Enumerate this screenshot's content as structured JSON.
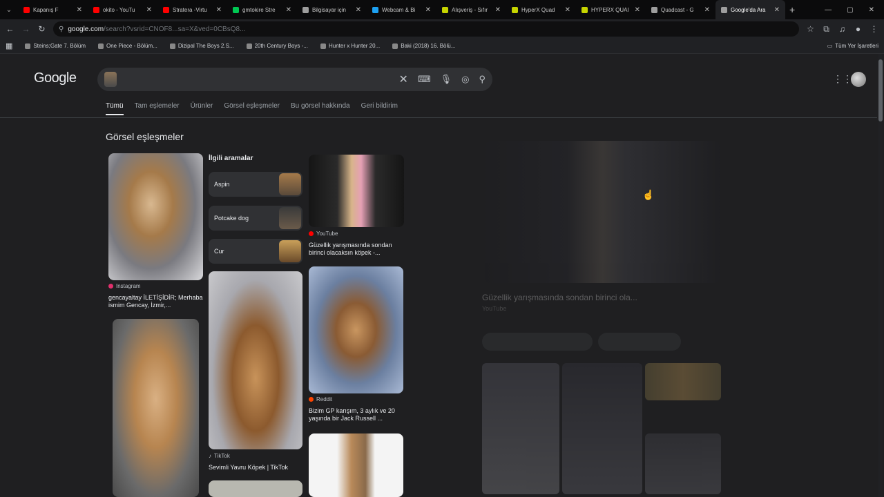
{
  "tabs": [
    {
      "label": "Kapanış F",
      "color": "#ff0000"
    },
    {
      "label": "okito - YouTu",
      "color": "#ff0000"
    },
    {
      "label": "Stratera -Virtu",
      "color": "#ff0000"
    },
    {
      "label": "gmtokire Stre",
      "color": "#00c853"
    },
    {
      "label": "Bilgisayar için",
      "color": "#9e9e9e"
    },
    {
      "label": "Webcam & Bi",
      "color": "#1da1f2"
    },
    {
      "label": "Alışveriş - Sıfır",
      "color": "#c6d400"
    },
    {
      "label": "HyperX Quad",
      "color": "#c6d400"
    },
    {
      "label": "HYPERX QUAI",
      "color": "#c6d400"
    },
    {
      "label": "Quadcast - G",
      "color": "#9e9e9e"
    },
    {
      "label": "Google'da Ara",
      "color": "#9e9e9e"
    }
  ],
  "address": {
    "host": "google.com",
    "rest": "/search?vsrid=CNOF8...sa=X&ved=0CBsQ8..."
  },
  "bookmarks": [
    "Steins;Gate 7. Bölüm",
    "One Piece - Bölüm...",
    "Dizipal The Boys 2.S...",
    "20th Century Boys -...",
    "Hunter x Hunter 20...",
    "Baki (2018) 16. Bölü..."
  ],
  "bookmarks_right": "Tüm Yer İşaretleri",
  "google": {
    "logo": "Google",
    "filters": [
      "Tümü",
      "Tam eşlemeler",
      "Ürünler",
      "Görsel eşleşmeler",
      "Bu görsel hakkında",
      "Geri bildirim"
    ],
    "section_title": "Görsel eşleşmeler",
    "related_title": "İlgili aramalar",
    "related": [
      "Aspin",
      "Potcake dog",
      "Cur"
    ],
    "results": {
      "r1_source": "Instagram",
      "r1_caption": "gencayaltay İLETİŞİDİR; Merhaba ismim Gencay, İzmir,...",
      "r2_source": "YouTube",
      "r2_caption": "Güzellik yarışmasında sondan birinci olacaksın köpek -...",
      "r3_source": "Reddit",
      "r3_caption": "Bizim GP karışım, 3 aylık ve 20 yaşında bir Jack Russell ...",
      "r4_source": "TikTok",
      "r4_caption": "Sevimli Yavru Köpek | TikTok"
    }
  },
  "detail": {
    "title": "Güzellik yarışmasında sondan birinci ola...",
    "subtitle": "YouTube"
  }
}
